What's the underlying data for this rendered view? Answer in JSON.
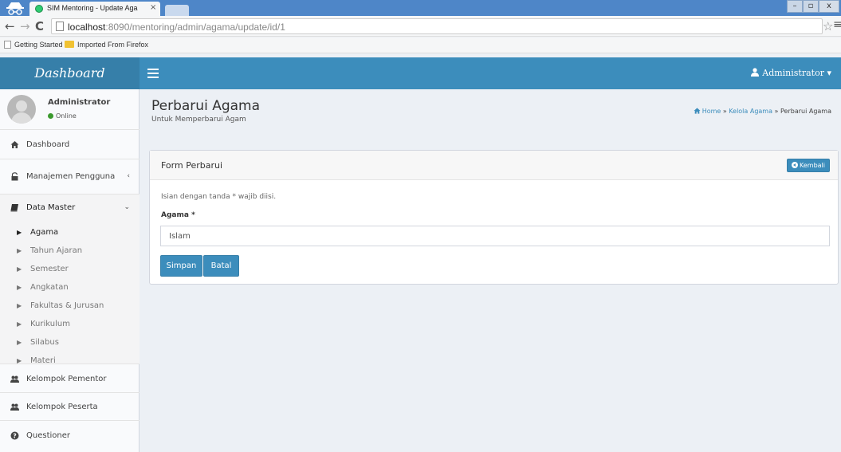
{
  "browser": {
    "tab_title": "SIM Mentoring - Update Aga",
    "tab_close": "×",
    "url_host": "localhost",
    "url_path": ":8090/mentoring/admin/agama/update/id/1",
    "bookmarks": [
      "Getting Started",
      "Imported From Firefox"
    ],
    "window_controls": {
      "minimize": "–",
      "maximize": "▫",
      "close": "x"
    }
  },
  "header": {
    "brand": "Dashboard",
    "user_menu": "Administrator ▾"
  },
  "sidebar": {
    "user": {
      "name": "Administrator",
      "status": "Online"
    },
    "items": [
      {
        "label": "Dashboard",
        "icon": "home-icon"
      },
      {
        "label": "Manajemen Pengguna",
        "icon": "lock-icon",
        "chevron": "‹"
      },
      {
        "label": "Data Master",
        "icon": "book-icon",
        "chevron": "⌄",
        "children": [
          "Agama",
          "Tahun Ajaran",
          "Semester",
          "Angkatan",
          "Fakultas & Jurusan",
          "Kurikulum",
          "Silabus",
          "Materi"
        ]
      },
      {
        "label": "Kelompok Pementor",
        "icon": "users-icon"
      },
      {
        "label": "Kelompok Peserta",
        "icon": "users-icon"
      },
      {
        "label": "Questioner",
        "icon": "question-circle-icon"
      }
    ],
    "active_child": "Agama"
  },
  "content": {
    "title": "Perbarui Agama",
    "subtitle": "Untuk Memperbarui Agam",
    "breadcrumb": {
      "home": "Home",
      "sep": " » ",
      "parent": "Kelola Agama",
      "current": "Perbarui Agama"
    },
    "form": {
      "box_title": "Form Perbarui",
      "back_button": "Kembali",
      "hint": "Isian dengan tanda * wajib diisi.",
      "field_label": "Agama *",
      "field_value": "Islam",
      "save_button": "Simpan",
      "cancel_button": "Batal"
    }
  },
  "colors": {
    "brand_dark": "#367fa9",
    "brand": "#3c8dbc",
    "sidebar_bg": "#f9fafc",
    "content_bg": "#ecf0f5",
    "online": "#3c9a2e"
  }
}
